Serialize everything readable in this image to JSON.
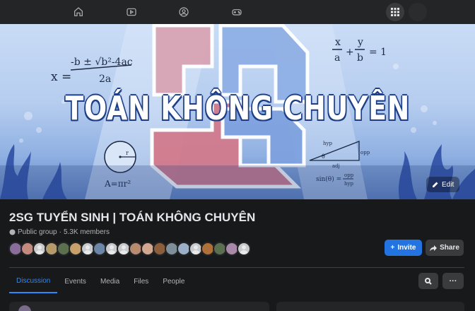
{
  "nav": {
    "items": [
      {
        "name": "home-icon"
      },
      {
        "name": "watch-icon"
      },
      {
        "name": "groups-icon"
      },
      {
        "name": "gaming-icon"
      }
    ],
    "apps_icon": "grid-menu-icon"
  },
  "cover": {
    "title": "TOÁN KHÔNG CHUYÊN",
    "formula_quadratic": "x = -b ± √b²-4ac / 2a",
    "formula_ellipse": "x/a + y/b = 1",
    "formula_circle": "A=πr²",
    "formula_sin": "sin(θ) = opp / hyp",
    "triangle_labels": [
      "hyp",
      "opp",
      "adj",
      "θ"
    ],
    "edit_label": "Edit"
  },
  "group": {
    "name": "2SG TUYỂN SINH | TOÁN KHÔNG CHUYÊN",
    "privacy": "Public group",
    "separator": "·",
    "members": "5.3K members",
    "invite_label": "Invite",
    "share_label": "Share"
  },
  "member_avatars": [
    "#8a6d9a",
    "#c48a7e",
    "blank",
    "#b59a6a",
    "#5c6f4e",
    "#c7a06a",
    "blank",
    "#6c86a8",
    "blank",
    "blank",
    "#b88a70",
    "#d2a890",
    "#8c5e3c",
    "#7f8f9a",
    "#9ab0c8",
    "blank",
    "#b0703a",
    "#5a7050",
    "#a88aa8",
    "blank"
  ],
  "tabs": [
    {
      "label": "Discussion",
      "active": true
    },
    {
      "label": "Events",
      "active": false
    },
    {
      "label": "Media",
      "active": false
    },
    {
      "label": "Files",
      "active": false
    },
    {
      "label": "People",
      "active": false
    }
  ],
  "actions": {
    "search_icon": "search-icon",
    "more_label": "···"
  },
  "colors": {
    "accent": "#2374e1",
    "active_tab": "#2d88ff",
    "background": "#18191a",
    "surface": "#242526"
  }
}
